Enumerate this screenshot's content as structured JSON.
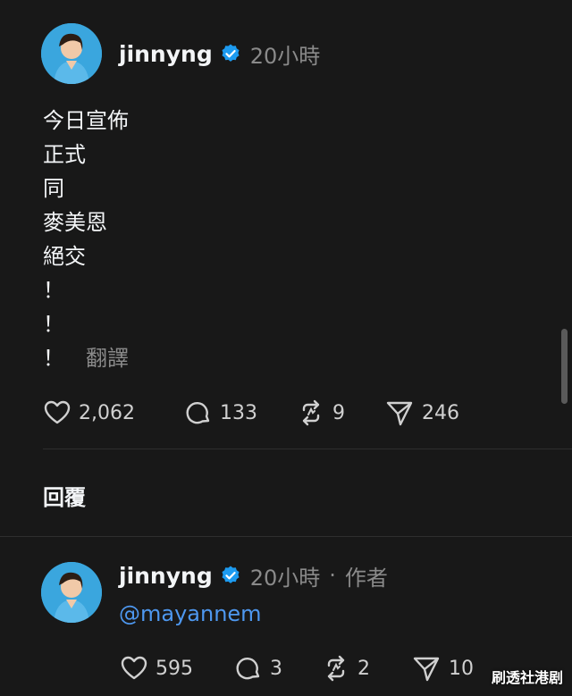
{
  "post": {
    "username": "jinnyng",
    "time": "20小時",
    "lines": [
      "今日宣佈",
      "正式",
      "同",
      "麥美恩",
      "絕交",
      "！",
      "！",
      "！"
    ],
    "translate_label": "翻譯",
    "stats": {
      "likes": "2,062",
      "comments": "133",
      "reposts": "9",
      "shares": "246"
    }
  },
  "reply_section": {
    "label": "回覆"
  },
  "reply": {
    "username": "jinnyng",
    "time": "20小時",
    "separator": "·",
    "author_label": "作者",
    "mention": "@mayannem",
    "stats": {
      "likes": "595",
      "comments": "3",
      "reposts": "2",
      "shares": "10"
    }
  },
  "watermark": "刷透社港剧",
  "colors": {
    "background": "#181818",
    "verified": "#1d9bf0",
    "mention": "#4e98f0",
    "muted": "#8a8a8a"
  },
  "icons": [
    "verified-badge-icon",
    "heart-icon",
    "comment-icon",
    "repost-icon",
    "share-icon"
  ]
}
